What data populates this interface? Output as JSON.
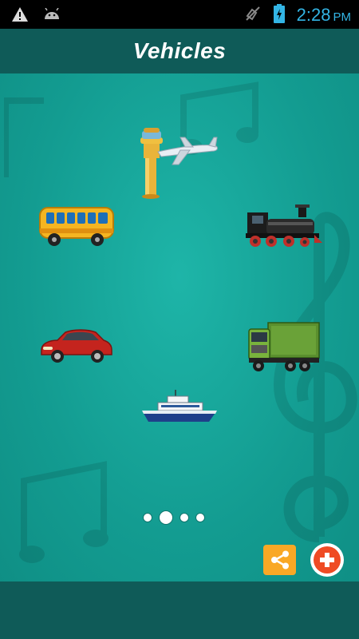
{
  "status_bar": {
    "icons": [
      "warning-icon",
      "android-icon",
      "mute-icon",
      "battery-charging-icon"
    ],
    "time": "2:28",
    "ampm": "PM"
  },
  "app_bar": {
    "title": "Vehicles"
  },
  "vehicles": [
    {
      "name": "airplane",
      "icon": "airplane-icon"
    },
    {
      "name": "bus",
      "icon": "bus-icon"
    },
    {
      "name": "train",
      "icon": "steam-train-icon"
    },
    {
      "name": "car",
      "icon": "car-icon"
    },
    {
      "name": "truck",
      "icon": "truck-icon"
    },
    {
      "name": "ship",
      "icon": "ship-icon"
    }
  ],
  "page_indicator": {
    "pages": 4,
    "current": 2
  },
  "actions": {
    "share_icon": "share-icon",
    "add_icon": "plus-icon"
  },
  "colors": {
    "background": "#16a69a",
    "bar": "#0f5b58",
    "status_accent": "#33b5e5",
    "share_button": "#f9a825",
    "add_button": "#ef4b24"
  }
}
